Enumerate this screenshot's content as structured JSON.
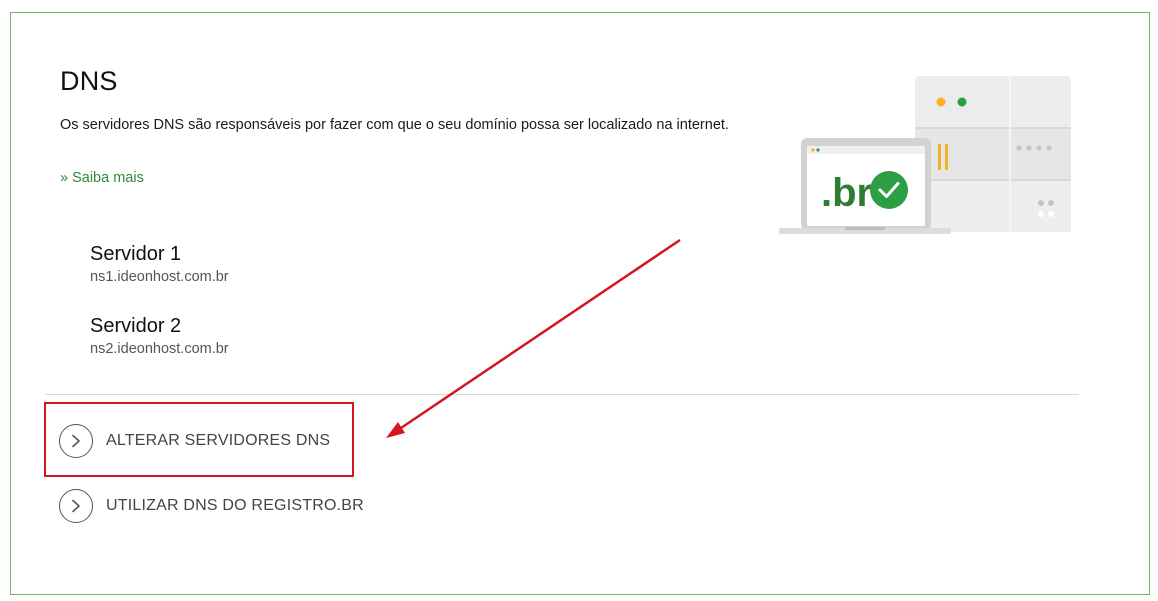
{
  "page": {
    "title": "DNS",
    "description": "Os servidores DNS são responsáveis por fazer com que o seu domínio possa ser localizado na internet.",
    "learn_more": "» Saiba mais"
  },
  "servers": [
    {
      "name": "Servidor 1",
      "host": "ns1.ideonhost.com.br"
    },
    {
      "name": "Servidor 2",
      "host": "ns2.ideonhost.com.br"
    }
  ],
  "actions": [
    {
      "label": "ALTERAR SERVIDORES DNS",
      "icon": "chevron-right-circle-icon"
    },
    {
      "label": "UTILIZAR DNS DO REGISTRO.BR",
      "icon": "chevron-right-circle-icon"
    }
  ],
  "illustration": {
    "badge_text": ".br",
    "icons": [
      "server-rack-icon",
      "laptop-icon",
      "check-circle-icon"
    ]
  },
  "colors": {
    "frame_border": "#7bb36b",
    "link_green": "#2f8a3a",
    "annotation_red": "#d4161d",
    "check_green": "#2e9e44",
    "accent_orange": "#f5b324"
  }
}
